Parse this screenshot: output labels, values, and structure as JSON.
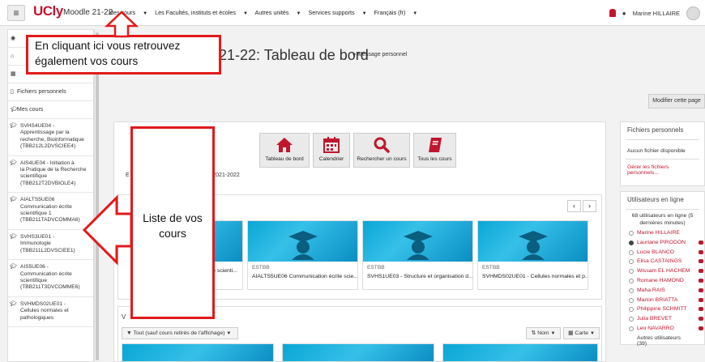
{
  "navbar": {
    "logo": "UCly",
    "site_name": "Moodle 21-22",
    "menu": [
      "Mes cours",
      "Les Facultés, instituts et écoles",
      "Autres unités",
      "Services supports",
      "Français (fr)"
    ],
    "user_name": "Marine HILLAIRE"
  },
  "drawer": {
    "items": [
      "Fichiers personnels",
      "Mes cours"
    ],
    "courses": [
      {
        "code": "SVHS4UE04 -",
        "name": "Apprentissage par la recherche, Bioinformatique",
        "ref": "(TBB212L2DVSCIEE4)"
      },
      {
        "code": "AIS4UE04 - Initiation à",
        "name": "la Pratique de la Recherche scientifique",
        "ref": "(TBB212T2DVBIOLE4)"
      },
      {
        "code": "AIALTS5UE06",
        "name": "Communication écrite scientifique 1",
        "ref": "(TBB211TADVCOMMA6)"
      },
      {
        "code": "SVHS3UE01 -",
        "name": "Immunologie",
        "ref": "(TBB211L2DVSCIEE1)"
      },
      {
        "code": "AIS5UE06 -",
        "name": "Communication écrite scientifique",
        "ref": "(TBB211T3DVCOMME6)"
      },
      {
        "code": "SVHMDS02UE01 -",
        "name": "Cellules normales et pathologiques",
        "ref": ""
      }
    ]
  },
  "main": {
    "title": "21-22: Tableau de bord",
    "message_link": "Message personnel",
    "modify_button": "Modifier cette page",
    "shortcuts": [
      "Tableau de bord",
      "Calendrier",
      "Rechercher un cours",
      "Tous les cours"
    ],
    "period_prefix": "E",
    "period_year": "- 2021-2022",
    "recent_courses": [
      {
        "category": "",
        "name": "re scienti..."
      },
      {
        "category": "ESTBB",
        "name": "AIALTS5UE06 Communication écrite scie..."
      },
      {
        "category": "ESTBB",
        "name": "SVHS1UE03 - Structure et organisation d..."
      },
      {
        "category": "ESTBB",
        "name": "SVHMDS02UE01 - Cellules normales et p..."
      }
    ],
    "overview_label": "V",
    "filter_label": "Tout (sauf cours retirés de l'affichage)",
    "sort_label": "Nom",
    "view_label": "Carte"
  },
  "right": {
    "files_title": "Fichiers personnels",
    "files_empty": "Aucun fichier disponible",
    "files_manage": "Gérer les fichiers personnels...",
    "online_title": "Utilisateurs en ligne",
    "online_count": "68 utilisateurs en ligne (5 dernières minutes)",
    "users": [
      "Marine HILLAIRE",
      "Lauriane PIRODON",
      "Lucie BLANCO",
      "Elisa CASTAINGS",
      "Wissam EL HACHEM",
      "Romane HAMOND",
      "Maha RAIS",
      "Marion BRIATTA",
      "Philippine SCHMITT",
      "Julia BREVET",
      "Leo NAVARRO"
    ],
    "others": "Autres utilisateurs (39)"
  },
  "annotations": {
    "top": "En cliquant ici vous retrouvez également vos cours",
    "left": "Liste de vos cours"
  },
  "colors": {
    "accent": "#c0172f",
    "annotation": "#e21a1a",
    "course_image": "#0aa6d6"
  }
}
